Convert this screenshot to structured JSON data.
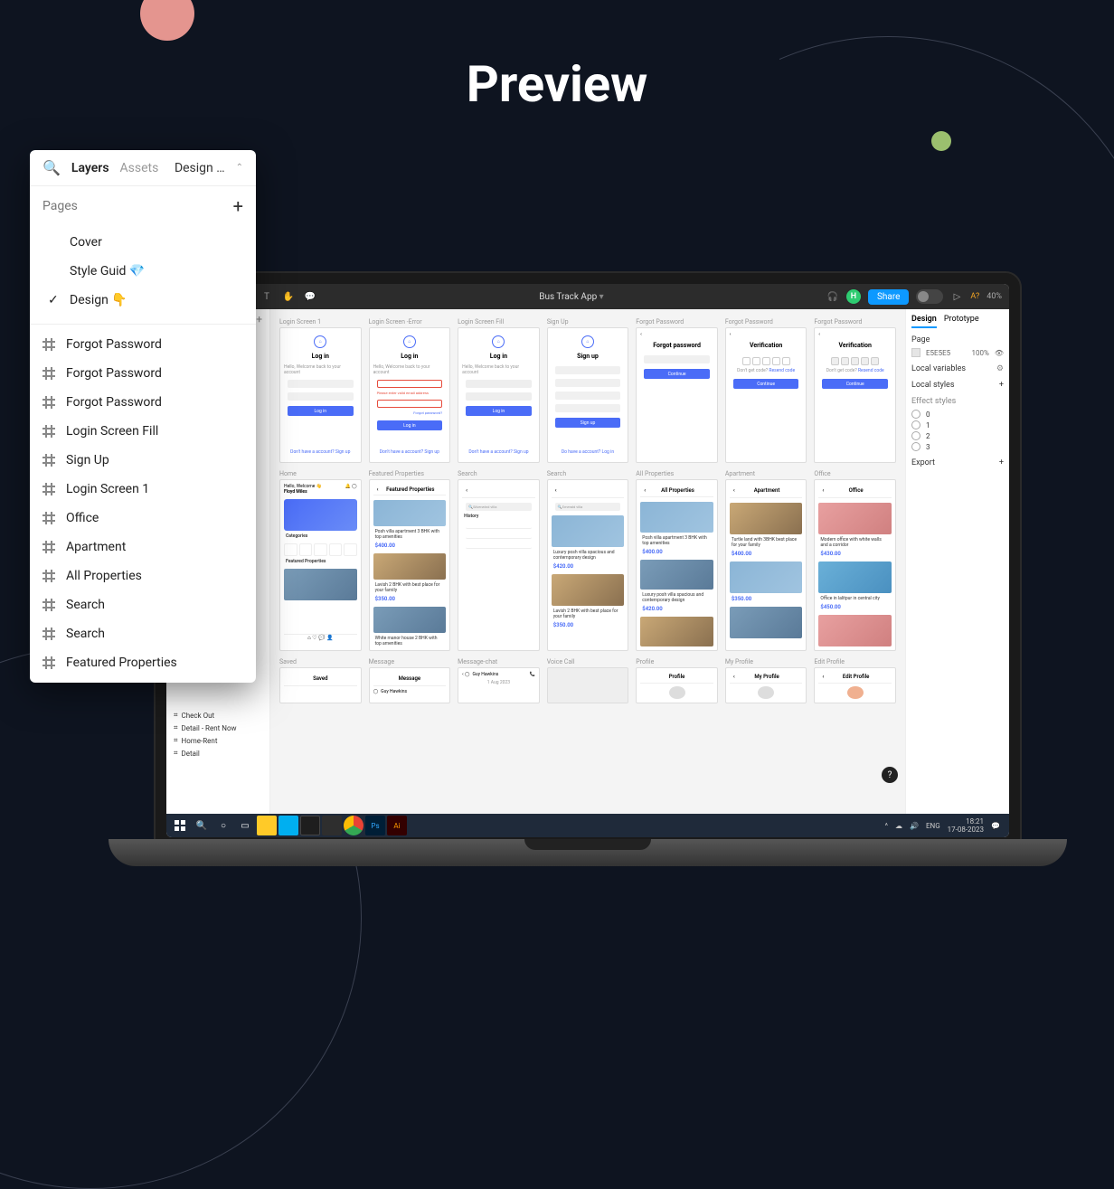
{
  "title": "Preview",
  "layers_panel": {
    "tabs": {
      "layers": "Layers",
      "assets": "Assets"
    },
    "file_name": "Design …",
    "pages_header": "Pages",
    "pages": {
      "cover": "Cover",
      "style_guid": "Style Guid 💎",
      "design": "Design 👇"
    },
    "layers": [
      "Forgot Password",
      "Forgot Password",
      "Forgot Password",
      "Login Screen Fill",
      "Sign Up",
      "Login Screen 1",
      "Office",
      "Apartment",
      "All Properties",
      "Search",
      "Search",
      "Featured Properties"
    ]
  },
  "figma": {
    "file_title": "Bus Track App",
    "avatar_initial": "H",
    "share": "Share",
    "a_badge": "A?",
    "zoom": "40%",
    "left_rows": [
      "Check Out",
      "Detail - Rent Now",
      "Home-Rent",
      "Detail"
    ],
    "right": {
      "tab_design": "Design",
      "tab_prototype": "Prototype",
      "page": "Page",
      "color_val": "E5E5E5",
      "color_pct": "100%",
      "local_vars": "Local variables",
      "local_styles": "Local styles",
      "effect_styles": "Effect styles",
      "eff0": "0",
      "eff1": "1",
      "eff2": "2",
      "eff3": "3",
      "export": "Export"
    }
  },
  "artboards": {
    "row1": {
      "login1": {
        "label": "Login Screen 1",
        "h": "Log in",
        "sub": "Hello, Welcome back to your account",
        "btn": "Log in",
        "foot": "Don't have a account? ",
        "foot_link": "Sign up"
      },
      "login_err": {
        "label": "Login Screen -Error",
        "h": "Log in",
        "err": "Please enter valid email address",
        "forgot": "Forgot password?",
        "btn": "Log in"
      },
      "login_fill": {
        "label": "Login Screen Fill",
        "h": "Log in",
        "btn": "Log in"
      },
      "signup": {
        "label": "Sign Up",
        "h": "Sign up",
        "btn": "Sign up",
        "foot": "Do have a account? ",
        "foot_link": "Log in"
      },
      "forgot1": {
        "label": "Forgot Password",
        "h": "Forgot password",
        "btn": "Continue"
      },
      "forgot2": {
        "label": "Forgot Password",
        "h": "Verification",
        "sub": "Don't get code? ",
        "link": "Resend code",
        "btn": "Continue"
      },
      "forgot3": {
        "label": "Forgot Password",
        "h": "Verification",
        "btn": "Continue"
      }
    },
    "row2": {
      "home": {
        "label": "Home",
        "greet": "Hello, Welcome 👋",
        "name": "Floyd Miles",
        "cats": "Categories",
        "feat": "Featured Properties"
      },
      "featured": {
        "label": "Featured Properties",
        "h": "Featured Properties",
        "t1": "Posh villa apartment 3 BHK with top amenities",
        "p1": "$400.00",
        "t2": "Lavish 2 BHK with best place for your family",
        "p2": "$350.00",
        "t3": "White manor house 2 BHK with top amenities"
      },
      "search1": {
        "label": "Search",
        "ph": "Silverwind villa",
        "h1": "History"
      },
      "search2": {
        "label": "Search",
        "ph": "Emerald villa",
        "t1": "Luxury posh villa spacious and contemporary design",
        "p1": "$420.00",
        "t2": "Lavish 2 BHK with best place for your family",
        "p2": "$350.00"
      },
      "allprop": {
        "label": "All Properties",
        "h": "All Properties",
        "t1": "Posh villa apartment 3 BHK with top amenities",
        "p1": "$400.00",
        "t2": "Luxury posh villa spacious and contemporary design",
        "p2": "$420.00"
      },
      "apartment": {
        "label": "Apartment",
        "h": "Apartment",
        "t1": "Turtle land with 3BHK best place for your family",
        "p1": "$400.00",
        "p2": "$350.00"
      },
      "office": {
        "label": "Office",
        "h": "Office",
        "t1": "Modern office with white walls and a corridor",
        "p1": "$430.00",
        "t2": "Office in lalitpur in central city",
        "p2": "$450.00"
      }
    },
    "row3": {
      "saved": {
        "label": "Saved",
        "h": "Saved"
      },
      "message": {
        "label": "Message",
        "h": "Message",
        "name": "Guy Hawkins"
      },
      "msgchat": {
        "label": "Message-chat",
        "name": "Guy Hawkins",
        "date": "1 Aug 2023"
      },
      "voice": {
        "label": "Voice Call"
      },
      "profile": {
        "label": "Profile",
        "h": "Profile"
      },
      "myprofile": {
        "label": "My Profile",
        "h": "My Profile"
      },
      "editprofile": {
        "label": "Edit Profile",
        "h": "Edit Profile"
      }
    }
  },
  "taskbar": {
    "lang": "ENG",
    "time": "18:21",
    "date": "17-08-2023"
  }
}
